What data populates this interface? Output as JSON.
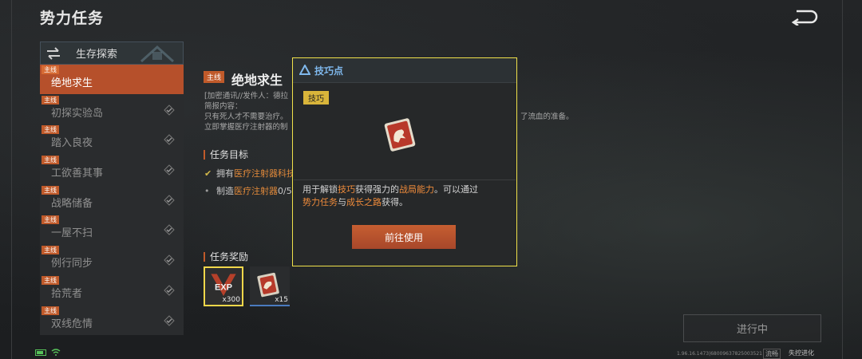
{
  "header": {
    "title": "势力任务"
  },
  "sidebar": {
    "category": "生存探索",
    "items": [
      {
        "tag": "主线",
        "label": "绝地求生",
        "active": true
      },
      {
        "tag": "主线",
        "label": "初探实验岛"
      },
      {
        "tag": "主线",
        "label": "踏入良夜"
      },
      {
        "tag": "主线",
        "label": "工欲善其事"
      },
      {
        "tag": "主线",
        "label": "战略储备"
      },
      {
        "tag": "主线",
        "label": "一屋不扫"
      },
      {
        "tag": "主线",
        "label": "例行同步"
      },
      {
        "tag": "主线",
        "label": "拾荒者"
      },
      {
        "tag": "主线",
        "label": "双线危情"
      }
    ]
  },
  "mission": {
    "tag": "主线",
    "title": "绝地求生",
    "line1": "[加密通讯//发件人：德拉",
    "line2": "简报内容：",
    "line3": "只有死人才不需要治疗。",
    "line4": "立即掌握医疗注射器的制",
    "line_tail": "了流血的准备。",
    "objectives_title": "任务目标",
    "goal1_prefix": "拥有",
    "goal1_highlight": "医疗注射器科技",
    "goal2_prefix": "制造",
    "goal2_highlight": "医疗注射器",
    "goal2_progress": "0/5",
    "rewards_title": "任务奖励",
    "rewards": [
      {
        "icon": "exp-icon",
        "label": "EXP",
        "count": "x300"
      },
      {
        "icon": "skill-point-icon",
        "count": "x15"
      }
    ],
    "status": "进行中"
  },
  "popup": {
    "title": "技巧点",
    "badge": "技巧",
    "desc_a": "用于解锁",
    "desc_b": "技巧",
    "desc_c": "获得强力的",
    "desc_d": "战局能力",
    "desc_e": "。可以通过",
    "desc_f": "势力任务",
    "desc_g": "与",
    "desc_h": "成长之路",
    "desc_i": "获得。",
    "button": "前往使用"
  },
  "footer": {
    "version": "1.96.16.1473|68009637825003521",
    "flow": "流畅",
    "brand": "失控进化"
  },
  "colors": {
    "accent": "#c05a2a",
    "highlight": "#f0e14a",
    "popup_title": "#7fb8ec"
  }
}
